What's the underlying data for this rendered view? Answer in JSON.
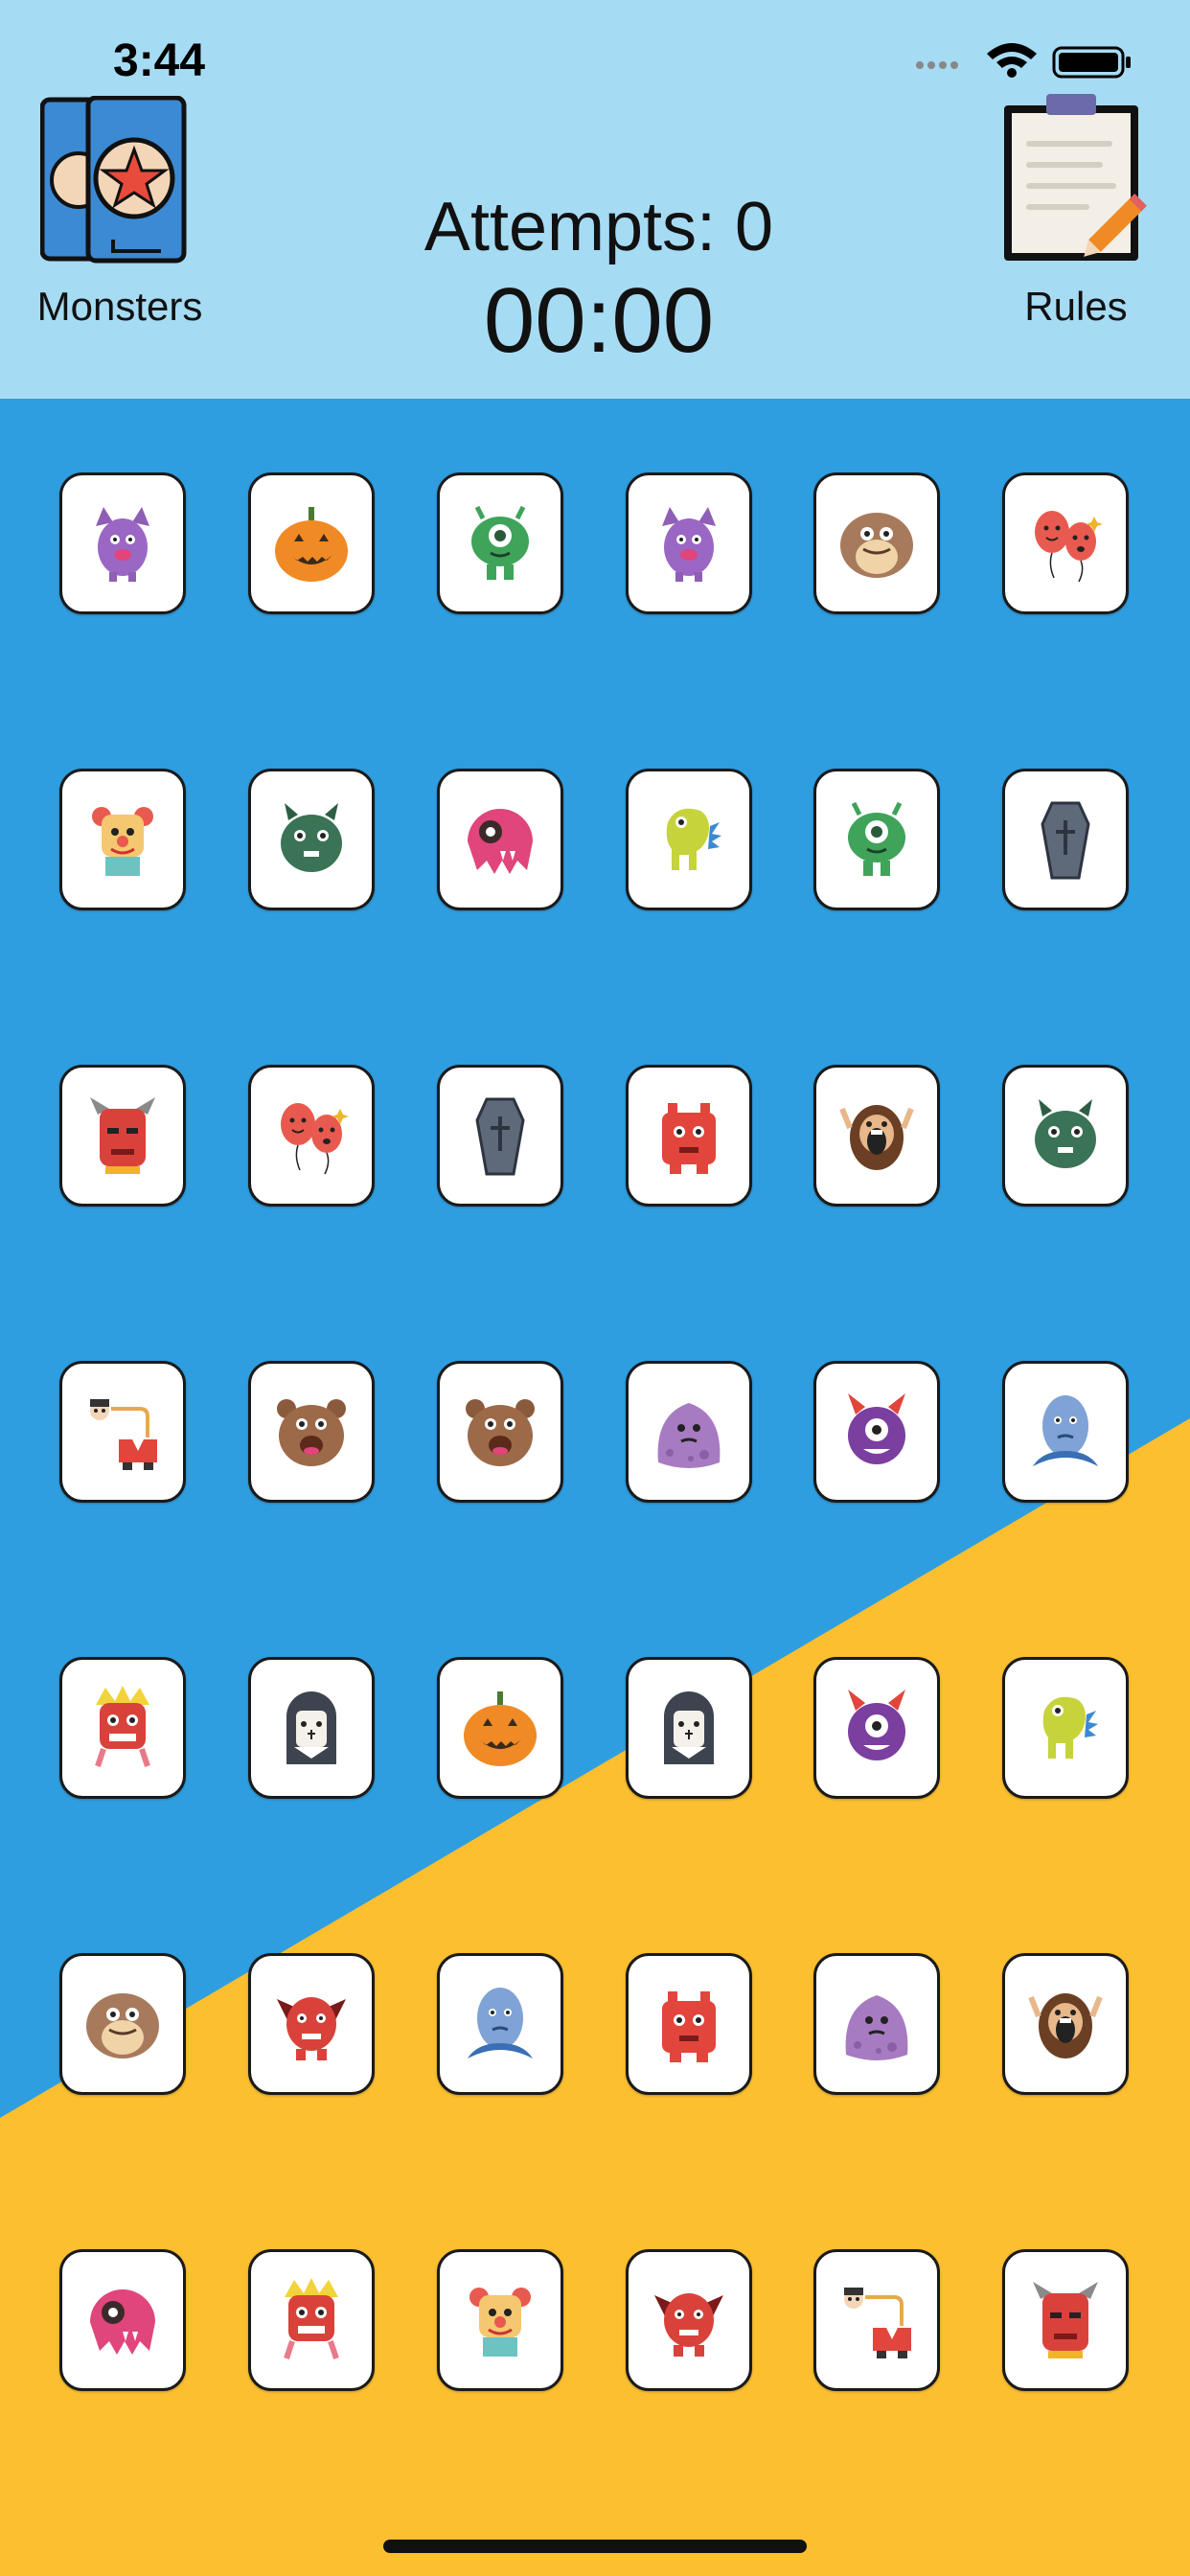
{
  "status_bar": {
    "time": "3:44"
  },
  "header": {
    "monsters_label": "Monsters",
    "rules_label": "Rules",
    "attempts_label": "Attempts: 0",
    "timer": "00:00"
  },
  "colors": {
    "header_bg": "#a6dbf4",
    "blue_bg": "#2f9ee0",
    "yellow_bg": "#fbbf30"
  },
  "cards": [
    [
      "purple-bat-monster-icon",
      "pumpkin-icon",
      "green-cyclops-icon",
      "purple-bat-monster-icon",
      "brown-furry-monster-icon",
      "balloon-faces-icon"
    ],
    [
      "clown-icon",
      "green-horned-monster-icon",
      "pink-one-eye-blob-icon",
      "yellow-dino-icon",
      "green-cyclops-icon",
      "coffin-icon"
    ],
    [
      "red-devil-mask-icon",
      "balloon-faces-icon",
      "coffin-icon",
      "red-square-monster-icon",
      "screaming-caveman-icon",
      "green-horned-monster-icon"
    ],
    [
      "puppet-on-string-icon",
      "brown-bear-monster-icon",
      "brown-bear-monster-icon",
      "lilac-blob-icon",
      "purple-horned-cyclops-icon",
      "blue-ghost-icon"
    ],
    [
      "red-tiki-icon",
      "vampire-icon",
      "pumpkin-icon",
      "vampire-icon",
      "purple-horned-cyclops-icon",
      "yellow-dino-icon"
    ],
    [
      "brown-furry-monster-icon",
      "red-winged-demon-icon",
      "blue-ghost-icon",
      "red-square-monster-icon",
      "lilac-blob-icon",
      "screaming-caveman-icon"
    ],
    [
      "pink-one-eye-blob-icon",
      "red-tiki-icon",
      "clown-icon",
      "red-winged-demon-icon",
      "puppet-on-string-icon",
      "red-devil-mask-icon"
    ]
  ]
}
